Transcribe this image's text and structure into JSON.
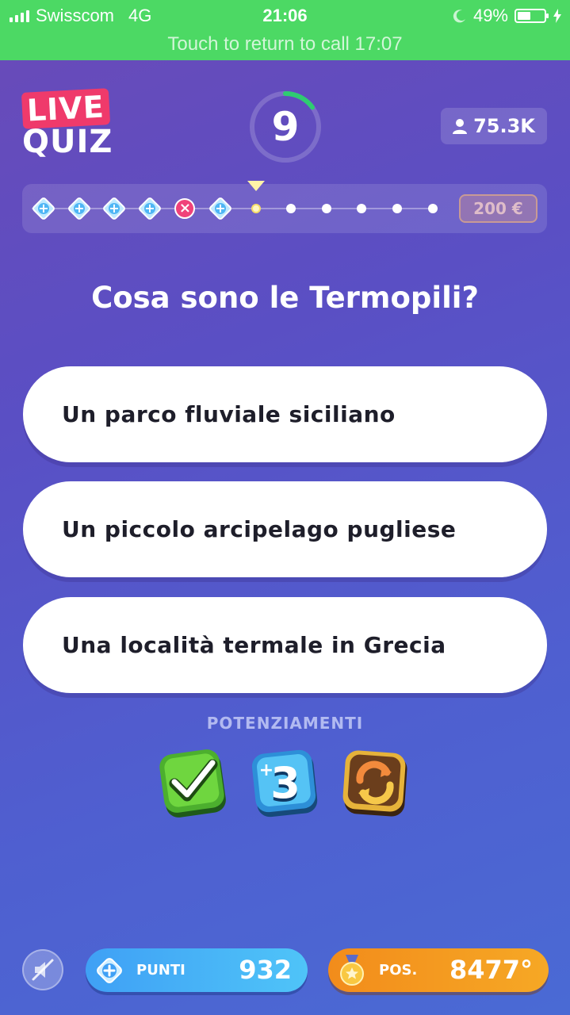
{
  "status_bar": {
    "carrier": "Swisscom",
    "network": "4G",
    "time": "21:06",
    "battery": "49%",
    "battery_level": 0.49
  },
  "call_banner": "Touch to return to call 17:07",
  "logo": {
    "live": "LIVE",
    "quiz": "QUIZ"
  },
  "timer": {
    "value": "9",
    "fraction_remaining": 0.15,
    "ring_color": "#2ecc71"
  },
  "viewers": {
    "count": "75.3K"
  },
  "progress": {
    "steps": [
      "life",
      "life",
      "life",
      "life",
      "wrong",
      "life",
      "current",
      "pending",
      "pending",
      "pending",
      "pending",
      "pending"
    ],
    "prize": "200 €"
  },
  "question": "Cosa sono le Termopili?",
  "answers": [
    "Un parco fluviale siciliano",
    "Un piccolo arcipelago pugliese",
    "Una località termale in Grecia"
  ],
  "powerups": {
    "title": "POTENZIAMENTI",
    "items": [
      "check-icon",
      "plus-three-icon",
      "swap-icon"
    ]
  },
  "bottom": {
    "score_label": "PUNTI",
    "score_value": "932",
    "position_label": "POS.",
    "position_value": "8477°"
  }
}
